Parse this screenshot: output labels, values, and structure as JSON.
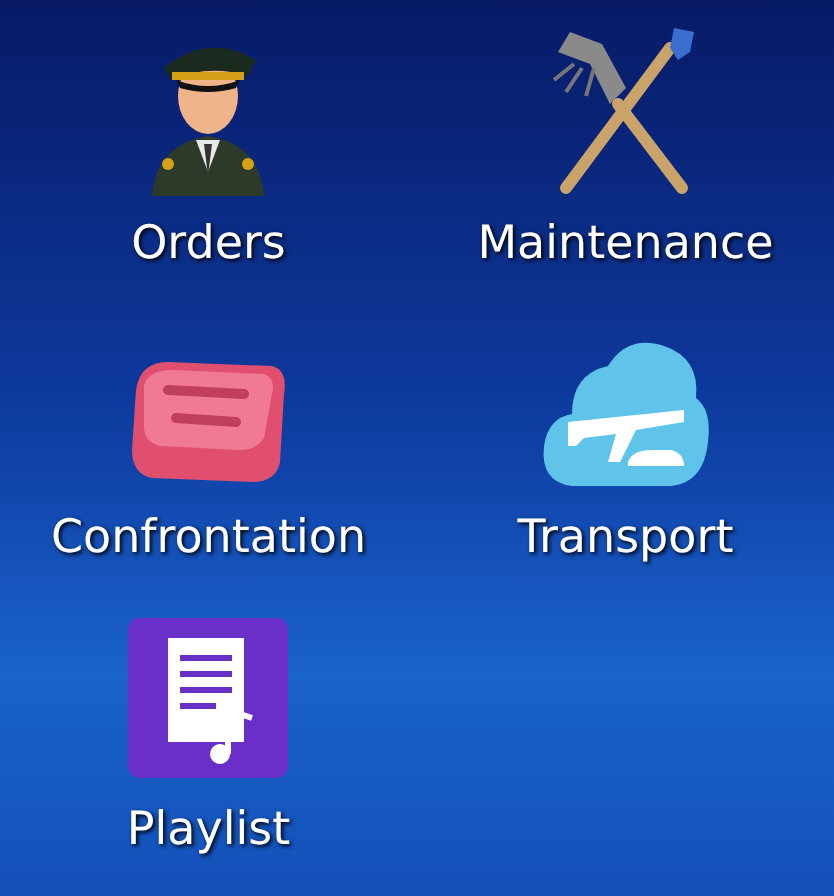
{
  "apps": [
    {
      "label": "Orders",
      "kind": "officer"
    },
    {
      "label": "Maintenance",
      "kind": "tools"
    },
    {
      "label": "Confrontation",
      "kind": "soap"
    },
    {
      "label": "Transport",
      "kind": "cloud"
    },
    {
      "label": "Playlist",
      "kind": "playlist"
    }
  ]
}
